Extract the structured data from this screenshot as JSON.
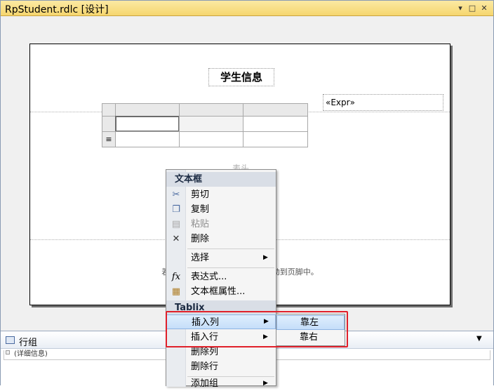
{
  "window": {
    "title": "RpStudent.rdlc [设计]",
    "controls": {
      "pin": "▾",
      "maximize": "□",
      "close": "✕"
    }
  },
  "report": {
    "title_text": "学生信息",
    "expr_text": "«Expr»",
    "table_header_text": "表头",
    "footer_hint": "若要向页脚中添加                                       然后再将其拖动到页脚中。"
  },
  "group_pane": {
    "title": "行组",
    "detail": "(详细信息)",
    "dropdown_icon": "chevron-down-icon"
  },
  "context_menu": {
    "section_textbox": "文本框",
    "items": [
      {
        "label": "剪切",
        "icon": "scissors-icon",
        "enabled": true
      },
      {
        "label": "复制",
        "icon": "copy-icon",
        "enabled": true
      },
      {
        "label": "粘贴",
        "icon": "paste-icon",
        "enabled": false
      },
      {
        "label": "删除",
        "icon": "delete-x-icon",
        "enabled": true
      }
    ],
    "select_label": "选择",
    "expression_label": "表达式...",
    "expression_icon": "fx-icon",
    "textbox_props_label": "文本框属性...",
    "textbox_props_icon": "properties-icon",
    "section_tablix": "Tablix",
    "insert_column_label": "插入列",
    "insert_row_label": "插入行",
    "delete_column_label": "删除列",
    "delete_row_label": "删除行",
    "add_group_label": "添加组"
  },
  "submenu": {
    "left_label": "靠左",
    "right_label": "靠右"
  },
  "colors": {
    "highlight_border": "#e0202a",
    "menu_highlight": "#c5def9",
    "title_bar": "#f6d66e"
  }
}
